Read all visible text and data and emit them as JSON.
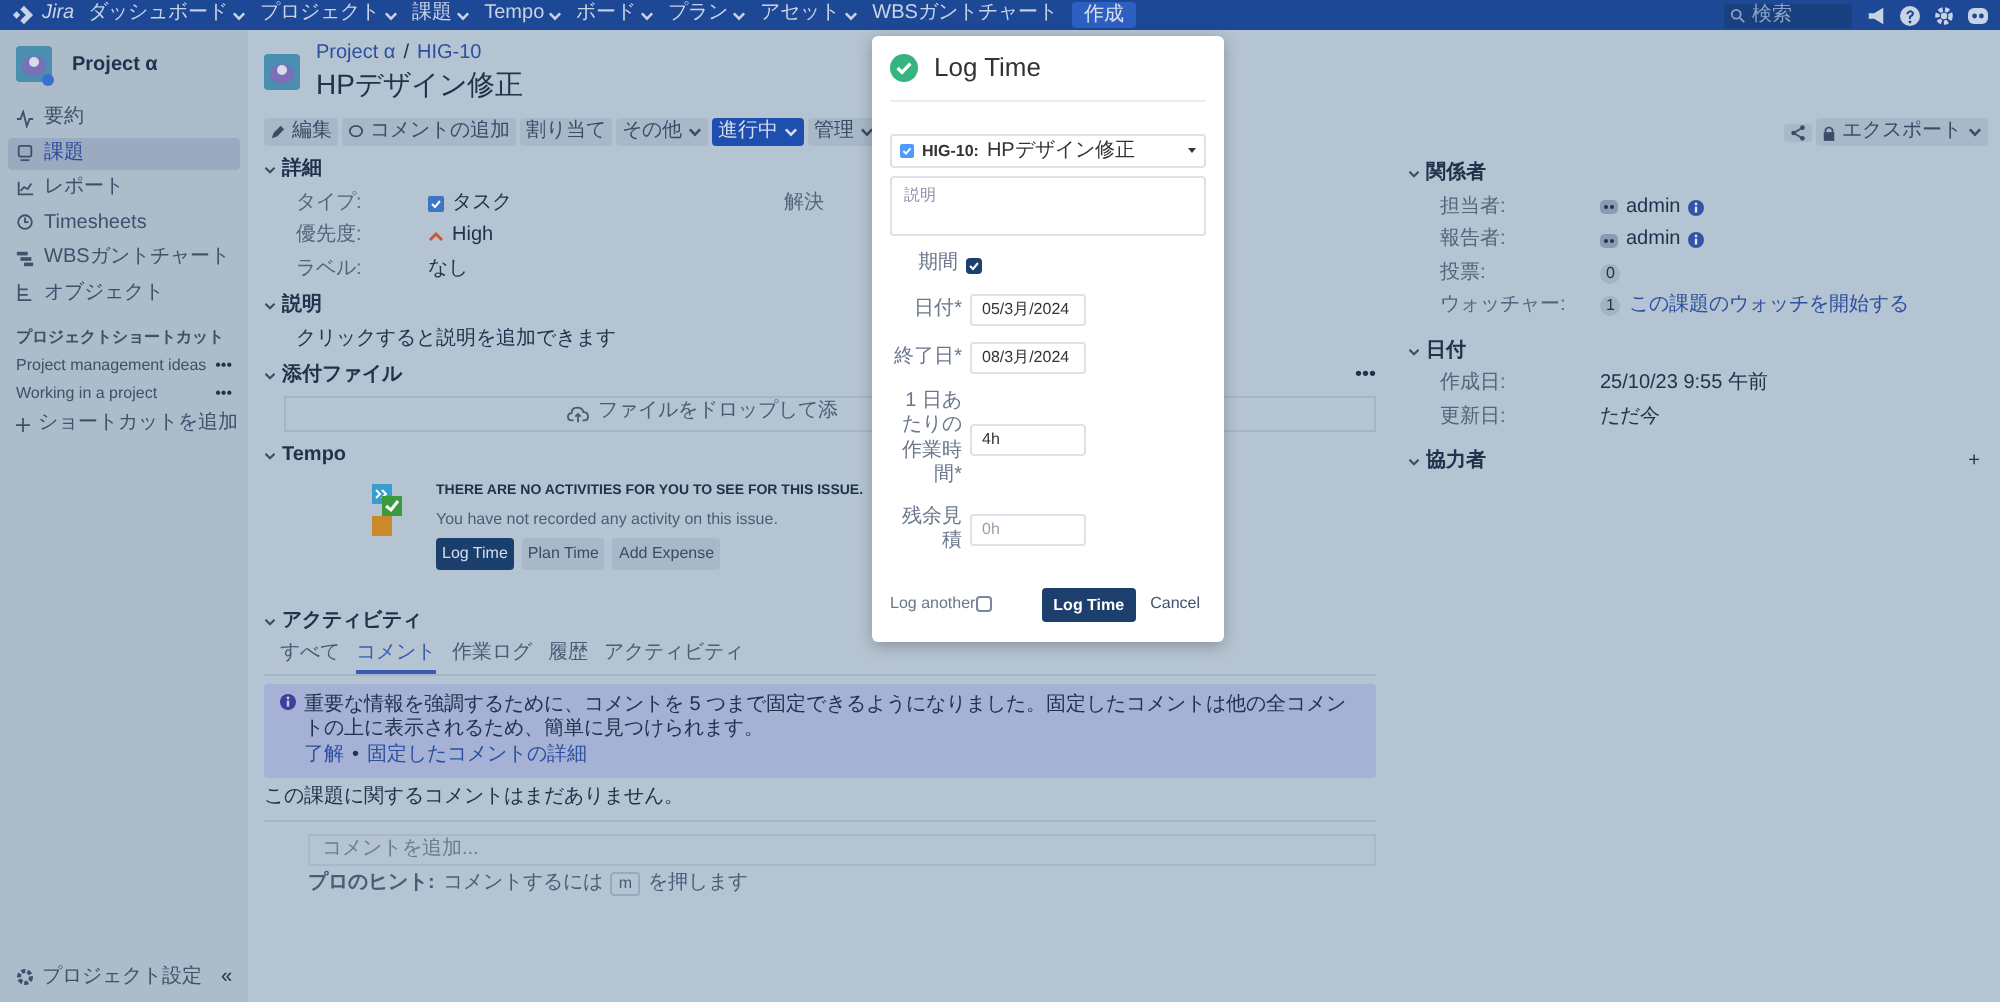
{
  "navbar": {
    "logo": "Jira",
    "menus": [
      {
        "label": "ダッシュボード",
        "dropdown": true
      },
      {
        "label": "プロジェクト",
        "dropdown": true
      },
      {
        "label": "課題",
        "dropdown": true
      },
      {
        "label": "Tempo",
        "dropdown": true
      },
      {
        "label": "ボード",
        "dropdown": true
      },
      {
        "label": "プラン",
        "dropdown": true
      },
      {
        "label": "アセット",
        "dropdown": true
      },
      {
        "label": "WBSガントチャート",
        "dropdown": false
      }
    ],
    "create_button": "作成",
    "search": {
      "placeholder": "検索"
    }
  },
  "sidebar": {
    "project": "Project α",
    "items": [
      {
        "label": "要約",
        "kind": "summary",
        "selected": false
      },
      {
        "label": "課題",
        "kind": "issues",
        "selected": true
      },
      {
        "label": "レポート",
        "kind": "reports",
        "selected": false
      },
      {
        "label": "Timesheets",
        "kind": "timesheets",
        "selected": false
      },
      {
        "label": "WBSガントチャート",
        "kind": "gantt",
        "selected": false
      },
      {
        "label": "オブジェクト",
        "kind": "objects",
        "selected": false
      }
    ],
    "shortcuts_heading": "プロジェクトショートカット",
    "shortcuts": [
      {
        "label": "Project management ideas",
        "more": "•••"
      },
      {
        "label": "Working in a project",
        "more": "•••"
      }
    ],
    "add_shortcut": "ショートカットを追加",
    "settings": "プロジェクト設定",
    "collapse": "«"
  },
  "issue": {
    "breadcrumbs": [
      "Project α",
      "HIG-10"
    ],
    "separator": "/",
    "title": "HPデザイン修正"
  },
  "toolbar": {
    "buttons": [
      {
        "label": "編集",
        "kind": "edit"
      },
      {
        "label": "コメントの追加",
        "kind": "comment"
      },
      {
        "label": "割り当て",
        "kind": "plain"
      },
      {
        "label": "その他",
        "kind": "dropdown"
      },
      {
        "label": "進行中",
        "kind": "status"
      },
      {
        "label": "管理",
        "kind": "dropdown"
      }
    ],
    "export": "エクスポート"
  },
  "details": {
    "heading": "詳細",
    "fields": [
      {
        "label": "タイプ:",
        "value": "タスク",
        "kind": "type"
      },
      {
        "label": "優先度:",
        "value": "High",
        "kind": "priority"
      },
      {
        "label": "ラベル:",
        "value": "なし",
        "kind": "text"
      }
    ],
    "column_2_label": "解決"
  },
  "description": {
    "heading": "説明",
    "prompt": "クリックすると説明を追加できます"
  },
  "attachments": {
    "heading": "添付ファイル",
    "more": "•••",
    "drop_text": "ファイルをドロップして添"
  },
  "tempo": {
    "heading": "Tempo",
    "title": "THERE ARE NO ACTIVITIES FOR YOU TO SEE FOR THIS ISSUE.",
    "message": "You have not recorded any activity on this issue.",
    "buttons": [
      {
        "label": "Log Time",
        "kind": "primary"
      },
      {
        "label": "Plan Time",
        "kind": "default"
      },
      {
        "label": "Add Expense",
        "kind": "default"
      }
    ]
  },
  "activity": {
    "heading": "アクティビティ",
    "tabs": [
      {
        "label": "すべて",
        "selected": false
      },
      {
        "label": "コメント",
        "selected": true
      },
      {
        "label": "作業ログ",
        "selected": false
      },
      {
        "label": "履歴",
        "selected": false
      },
      {
        "label": "アクティビティ",
        "selected": false
      }
    ],
    "notice": {
      "text": "重要な情報を強調するために、コメントを 5 つまで固定できるようになりました。固定したコメントは他の全コメントの上に表示されるため、簡単に見つけられます。",
      "links": [
        "了解",
        "固定したコメントの詳細"
      ],
      "separator": "•"
    },
    "empty": "この課題に関するコメントはまだありません。",
    "comment_field": {
      "placeholder": "コメントを追加..."
    },
    "tip": {
      "label": "プロのヒント:",
      "before": "コメントするには",
      "key": "m",
      "after": "を押します"
    }
  },
  "people": {
    "heading": "関係者",
    "rows": [
      {
        "label": "担当者:",
        "value": "admin",
        "kind": "user"
      },
      {
        "label": "報告者:",
        "value": "admin",
        "kind": "user"
      },
      {
        "label": "投票:",
        "count": "0",
        "kind": "count"
      },
      {
        "label": "ウォッチャー:",
        "count": "1",
        "link": "この課題のウォッチを開始する",
        "kind": "count"
      }
    ]
  },
  "dates": {
    "heading": "日付",
    "rows": [
      {
        "label": "作成日:",
        "value": "25/10/23 9:55 午前"
      },
      {
        "label": "更新日:",
        "value": "ただ今"
      }
    ]
  },
  "collaborators": {
    "heading": "協力者",
    "add": "+"
  },
  "modal": {
    "title": "Log Time",
    "issue": {
      "key": "HIG-10:",
      "summary": "HPデザイン修正"
    },
    "description": {
      "placeholder": "説明"
    },
    "period": {
      "label": "期間",
      "checked": true
    },
    "fields": [
      {
        "label": "日付*",
        "value": "05/3月/2024"
      },
      {
        "label": "終了日*",
        "value": "08/3月/2024"
      },
      {
        "label": "1 日あたりの作業時間*",
        "value": "4h"
      },
      {
        "label": "残余見積",
        "placeholder": "0h"
      }
    ],
    "log_another": {
      "label": "Log another",
      "checked": false
    },
    "submit": "Log Time",
    "cancel": "Cancel"
  }
}
